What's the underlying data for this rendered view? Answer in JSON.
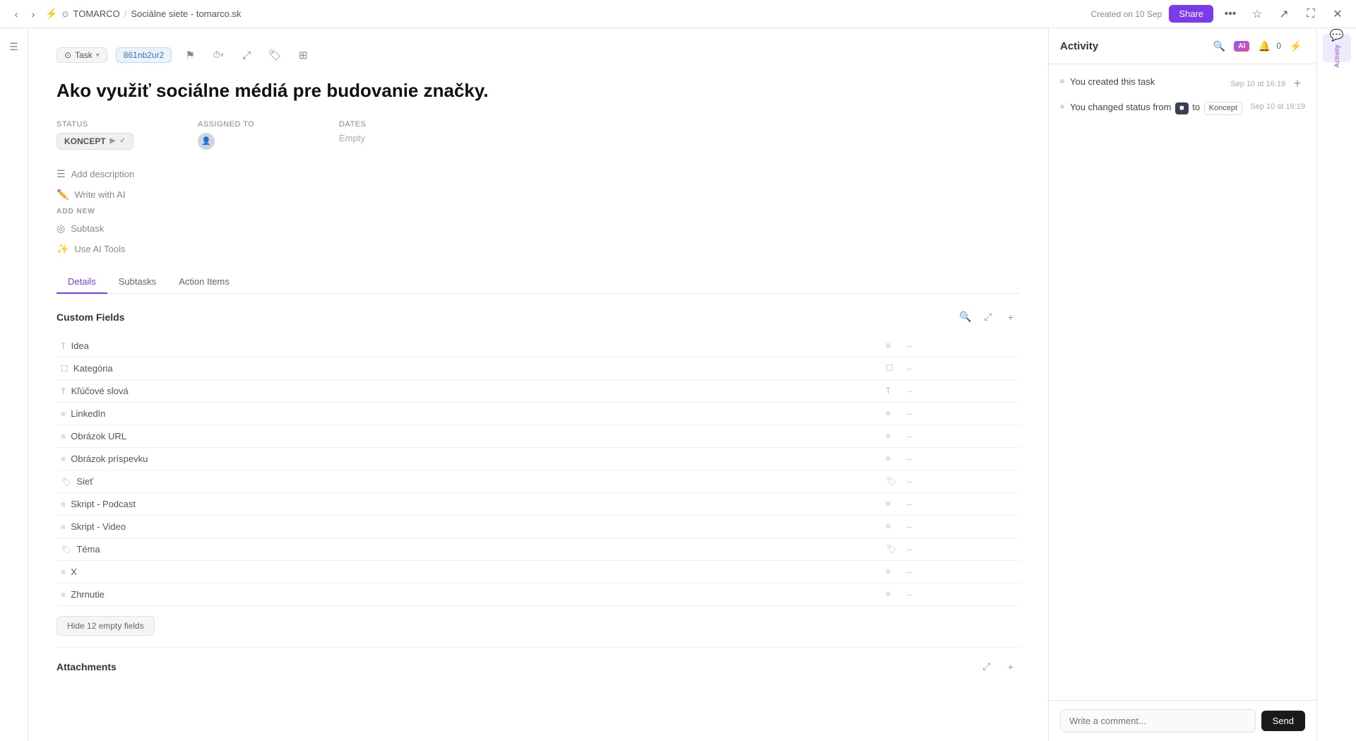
{
  "topbar": {
    "breadcrumb": {
      "project": "TOMARCO",
      "separator": "/",
      "page": "Sociálne siete - tomarco.sk"
    },
    "created_info": "Created on 10 Sep",
    "share_label": "Share",
    "task_id": "861nb2ur2",
    "task_type": "Task"
  },
  "task": {
    "title": "Ako využiť sociálne médiá pre budovanie značky.",
    "status_label": "KONCEPT",
    "assignee_placeholder": "👤",
    "dates_empty": "Empty",
    "fields": {
      "status": "Status",
      "assigned_to": "Assigned to",
      "dates": "Dates"
    },
    "desc_placeholder": "Add description",
    "write_ai_label": "Write with AI",
    "add_new_label": "ADD NEW",
    "subtask_label": "Subtask",
    "use_ai_label": "Use AI Tools"
  },
  "tabs": [
    {
      "id": "details",
      "label": "Details",
      "active": true
    },
    {
      "id": "subtasks",
      "label": "Subtasks",
      "active": false
    },
    {
      "id": "action-items",
      "label": "Action Items",
      "active": false
    }
  ],
  "custom_fields": {
    "title": "Custom Fields",
    "rows": [
      {
        "name": "Idea",
        "icon": "text-icon",
        "value": "–"
      },
      {
        "name": "Kategória",
        "icon": "checkbox-icon",
        "value": "–"
      },
      {
        "name": "Kľúčové slová",
        "icon": "T-icon",
        "value": "–"
      },
      {
        "name": "LinkedIn",
        "icon": "link-icon",
        "value": "–"
      },
      {
        "name": "Obrázok URL",
        "icon": "link-icon",
        "value": "–"
      },
      {
        "name": "Obrázok príspevku",
        "icon": "link-icon",
        "value": "–"
      },
      {
        "name": "Sieť",
        "icon": "tag-icon",
        "value": "–"
      },
      {
        "name": "Skript - Podcast",
        "icon": "link-icon",
        "value": "–"
      },
      {
        "name": "Skript - Video",
        "icon": "link-icon",
        "value": "–"
      },
      {
        "name": "Téma",
        "icon": "tag-icon",
        "value": "–"
      },
      {
        "name": "X",
        "icon": "link-icon",
        "value": "–"
      },
      {
        "name": "Zhrnutie",
        "icon": "link-icon",
        "value": "–"
      }
    ],
    "hide_empty_label": "Hide 12 empty fields"
  },
  "attachments": {
    "title": "Attachments"
  },
  "activity": {
    "title": "Activity",
    "items": [
      {
        "text": "You created this task",
        "time": "Sep 10 at 16:19"
      },
      {
        "text_parts": [
          "You changed status from",
          "■",
          "to",
          "Koncept"
        ],
        "time": "Sep 10 at 16:19"
      }
    ],
    "comment_placeholder": "Write a comment...",
    "send_label": "Send"
  },
  "icons": {
    "search": "🔍",
    "filter": "⚡",
    "bell": "🔔",
    "ai": "AI",
    "plus": "+",
    "expand": "⤢",
    "sidebar_toggle": "☰",
    "flag": "⚑",
    "time": "⏱",
    "link": "🔗",
    "tag": "🏷",
    "star": "☆",
    "more": "•••"
  }
}
